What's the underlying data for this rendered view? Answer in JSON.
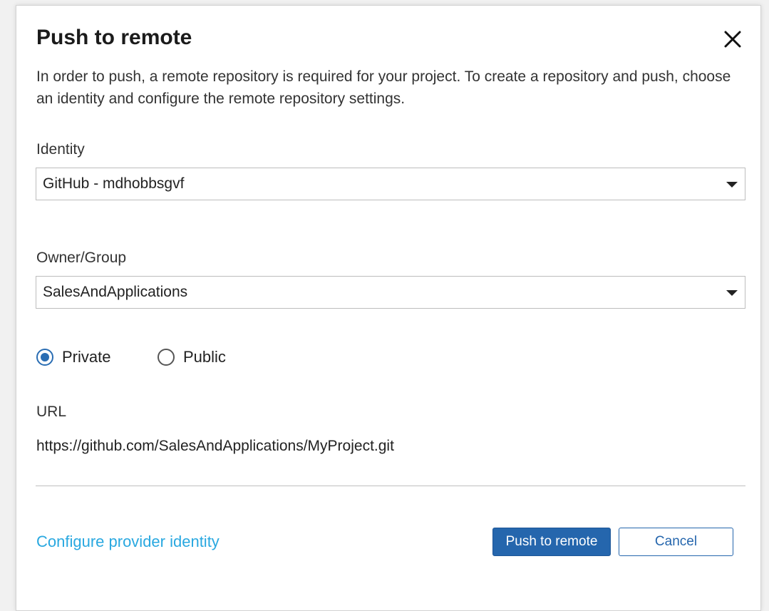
{
  "dialog": {
    "title": "Push to remote",
    "description": "In order to push, a remote repository is required for your project. To create a repository and push, choose an identity and configure the remote repository settings."
  },
  "identity": {
    "label": "Identity",
    "value": "GitHub - mdhobbsgvf"
  },
  "owner_group": {
    "label": "Owner/Group",
    "value": "SalesAndApplications"
  },
  "visibility": {
    "options": [
      {
        "label": "Private",
        "checked": true
      },
      {
        "label": "Public",
        "checked": false
      }
    ]
  },
  "url": {
    "label": "URL",
    "value": "https://github.com/SalesAndApplications/MyProject.git"
  },
  "footer": {
    "configure_link": "Configure provider identity",
    "push_label": "Push to remote",
    "cancel_label": "Cancel"
  },
  "icons": {
    "close": "close-icon",
    "dropdown": "caret-down-icon"
  },
  "colors": {
    "accent": "#2566ad",
    "link": "#29a8e0",
    "radio_selected": "#2a6db3"
  }
}
